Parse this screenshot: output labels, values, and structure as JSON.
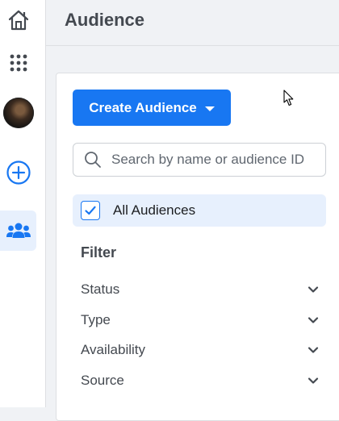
{
  "sidebar": {
    "items": [
      {
        "name": "home",
        "icon": "home-icon"
      },
      {
        "name": "all-tools",
        "icon": "grid-icon"
      },
      {
        "name": "profile",
        "icon": "avatar"
      },
      {
        "name": "create",
        "icon": "plus-circle-icon"
      },
      {
        "name": "audiences",
        "icon": "people-icon",
        "active": true
      }
    ]
  },
  "header": {
    "title": "Audience"
  },
  "panel": {
    "create_button_label": "Create Audience",
    "search_placeholder": "Search by name or audience ID",
    "all_audiences_label": "All Audiences",
    "all_audiences_checked": true,
    "filter_title": "Filter",
    "filters": [
      {
        "label": "Status"
      },
      {
        "label": "Type"
      },
      {
        "label": "Availability"
      },
      {
        "label": "Source"
      }
    ]
  },
  "colors": {
    "primary": "#1877f2",
    "selected_bg": "#e7f0fd",
    "page_bg": "#f0f2f5",
    "text_secondary": "#444950"
  }
}
